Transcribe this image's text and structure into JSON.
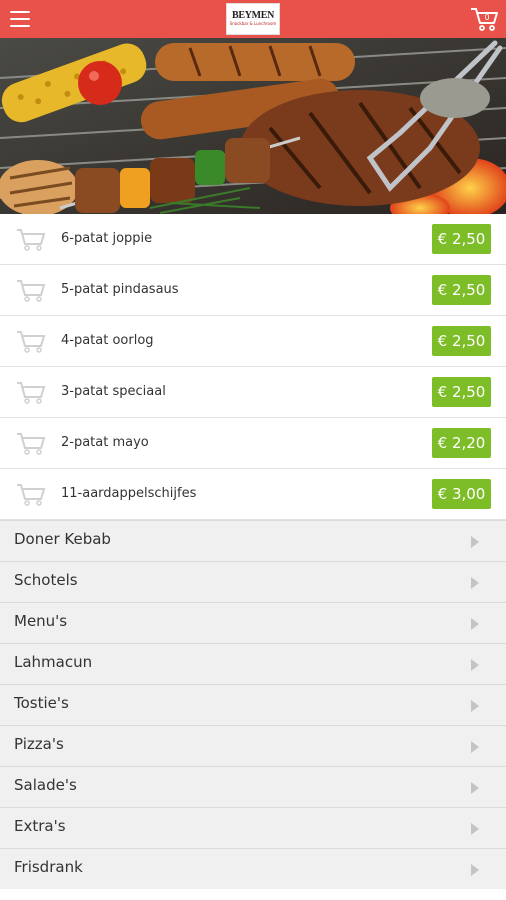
{
  "header": {
    "logo_text": "BEYMEN",
    "logo_subtext": "Snackbar & Lunchroom",
    "menu_icon": "hamburger-icon",
    "cart_icon": "shopping-cart-icon",
    "colors": {
      "bar": "#e8524a",
      "price": "#7cbd28"
    }
  },
  "hero": {
    "subject": "grilled meat, sausages, corn and kebab skewers on a barbecue"
  },
  "products": [
    {
      "name": "6-patat joppie",
      "price": "€ 2,50"
    },
    {
      "name": "5-patat pindasaus",
      "price": "€ 2,50"
    },
    {
      "name": "4-patat oorlog",
      "price": "€ 2,50"
    },
    {
      "name": "3-patat speciaal",
      "price": "€ 2,50"
    },
    {
      "name": "2-patat mayo",
      "price": "€ 2,20"
    },
    {
      "name": "11-aardappelschijfes",
      "price": "€ 3,00"
    }
  ],
  "categories": [
    {
      "label": "Doner Kebab"
    },
    {
      "label": "Schotels"
    },
    {
      "label": "Menu's"
    },
    {
      "label": "Lahmacun"
    },
    {
      "label": "Tostie's"
    },
    {
      "label": "Pizza's"
    },
    {
      "label": "Salade's"
    },
    {
      "label": "Extra's"
    },
    {
      "label": "Frisdrank"
    }
  ]
}
